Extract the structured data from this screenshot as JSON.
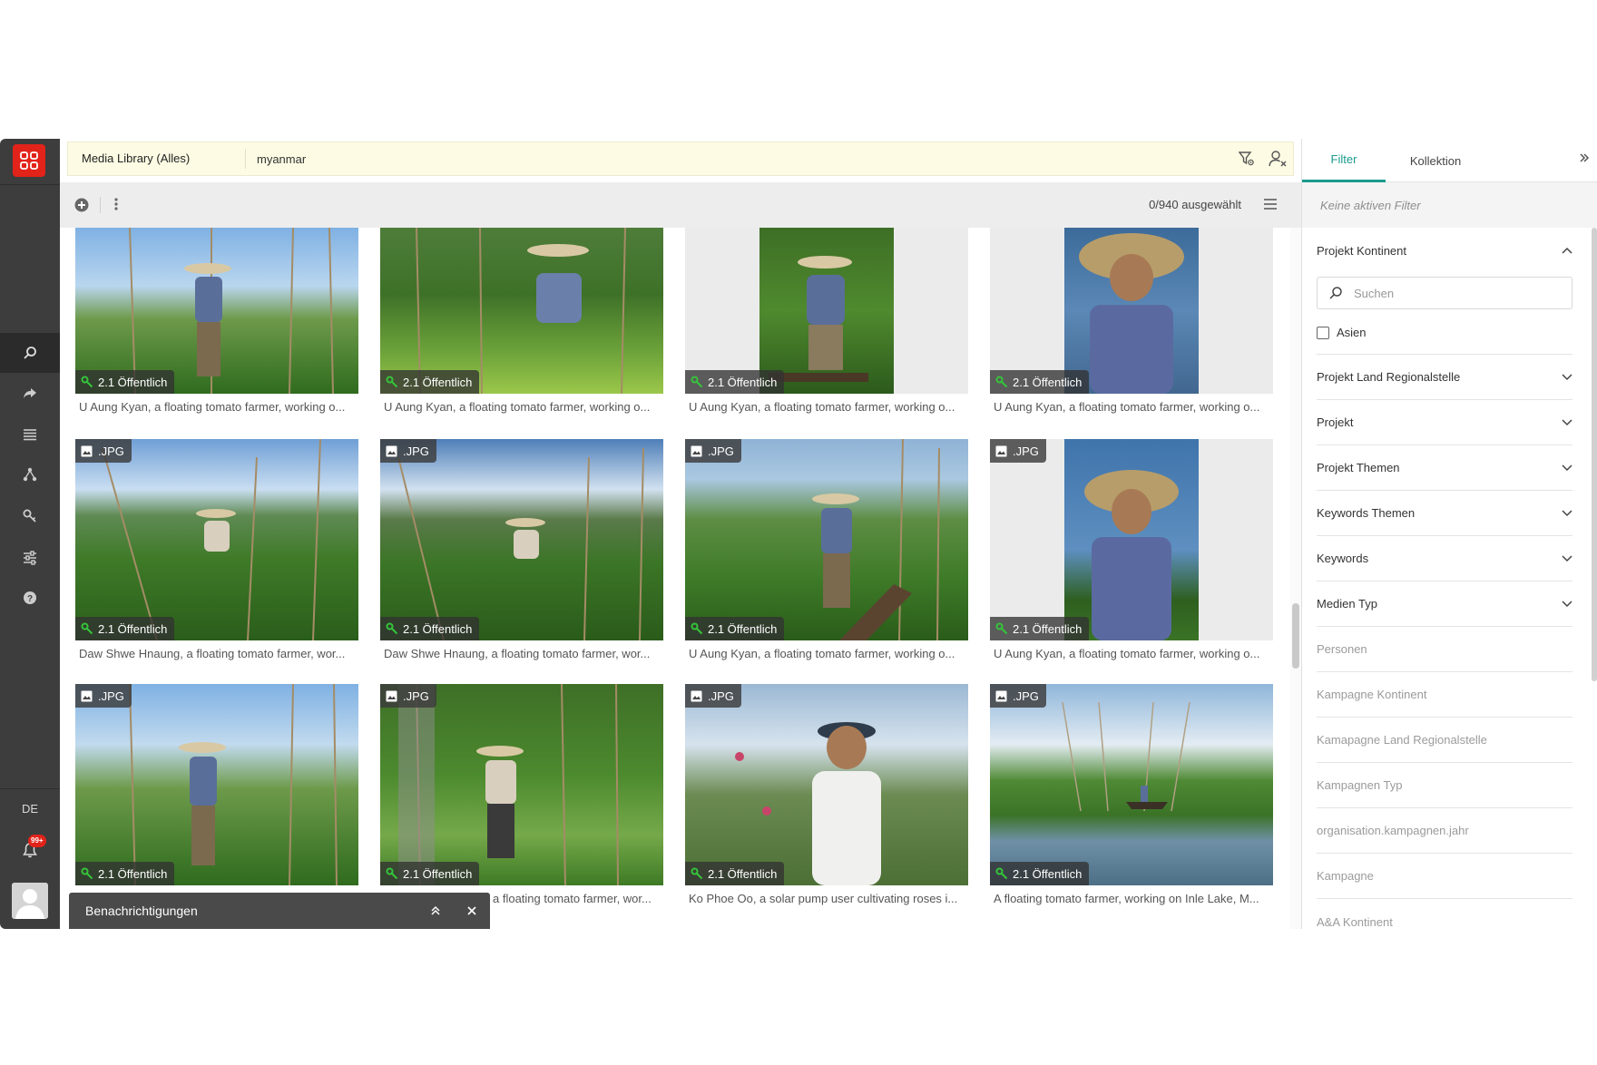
{
  "app": {
    "brand_color": "#e2231a",
    "accent_color": "#1a9a8c"
  },
  "search": {
    "scope": "Media Library (Alles)",
    "query": "myanmar"
  },
  "nav": {
    "icons": [
      "search-icon",
      "share-icon",
      "list-icon",
      "hierarchy-icon",
      "key-icon",
      "sliders-icon",
      "help-icon"
    ],
    "language": "DE",
    "notifications_badge": "99+"
  },
  "toolbar": {
    "selection_count": "0/940 ausgewählt"
  },
  "grid": {
    "cards": [
      {
        "type": "",
        "access": "2.1 Öffentlich",
        "caption": "U Aung Kyan, a floating tomato farmer, working o..."
      },
      {
        "type": "",
        "access": "2.1 Öffentlich",
        "caption": "U Aung Kyan, a floating tomato farmer, working o..."
      },
      {
        "type": "",
        "access": "2.1 Öffentlich",
        "caption": "U Aung Kyan, a floating tomato farmer, working o..."
      },
      {
        "type": "",
        "access": "2.1 Öffentlich",
        "caption": "U Aung Kyan, a floating tomato farmer, working o..."
      },
      {
        "type": ".JPG",
        "access": "2.1 Öffentlich",
        "caption": "Daw Shwe Hnaung, a floating tomato farmer, wor..."
      },
      {
        "type": ".JPG",
        "access": "2.1 Öffentlich",
        "caption": "Daw Shwe Hnaung, a floating tomato farmer, wor..."
      },
      {
        "type": ".JPG",
        "access": "2.1 Öffentlich",
        "caption": "U Aung Kyan, a floating tomato farmer, working o..."
      },
      {
        "type": ".JPG",
        "access": "2.1 Öffentlich",
        "caption": "U Aung Kyan, a floating tomato farmer, working o..."
      },
      {
        "type": ".JPG",
        "access": "2.1 Öffentlich",
        "caption": ""
      },
      {
        "type": ".JPG",
        "access": "2.1 Öffentlich",
        "caption": "a floating tomato farmer, wor..."
      },
      {
        "type": ".JPG",
        "access": "2.1 Öffentlich",
        "caption": "Ko Phoe Oo, a solar pump user cultivating roses i..."
      },
      {
        "type": ".JPG",
        "access": "2.1 Öffentlich",
        "caption": "A floating tomato farmer, working on Inle Lake, M..."
      }
    ]
  },
  "notifications": {
    "title": "Benachrichtigungen"
  },
  "right_panel": {
    "tabs": [
      "Filter",
      "Kollektion"
    ],
    "active_tab": "Filter",
    "no_filters": "Keine aktiven Filter",
    "open_facet": {
      "label": "Projekt Kontinent",
      "search_placeholder": "Suchen",
      "option": "Asien"
    },
    "facets": [
      "Projekt Land Regionalstelle",
      "Projekt",
      "Projekt Themen",
      "Keywords Themen",
      "Keywords",
      "Medien Typ"
    ],
    "disabled_facets": [
      "Personen",
      "Kampagne Kontinent",
      "Kamapagne Land Regionalstelle",
      "Kampagnen Typ",
      "organisation.kampagnen.jahr",
      "Kampagne",
      "A&A Kontinent"
    ]
  }
}
